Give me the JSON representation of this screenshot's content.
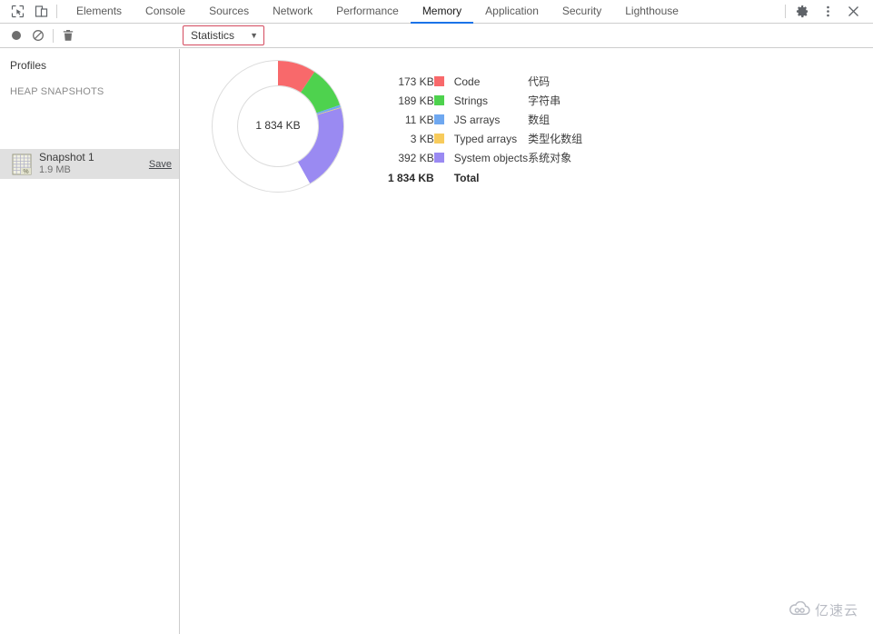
{
  "window": {
    "tabbar": {
      "left_icons": [
        {
          "name": "inspect-element-icon",
          "glyph": "inspect"
        },
        {
          "name": "device-toolbar-icon",
          "glyph": "device"
        }
      ],
      "tabs": [
        {
          "label": "Elements",
          "active": false
        },
        {
          "label": "Console",
          "active": false
        },
        {
          "label": "Sources",
          "active": false
        },
        {
          "label": "Network",
          "active": false
        },
        {
          "label": "Performance",
          "active": false
        },
        {
          "label": "Memory",
          "active": true
        },
        {
          "label": "Application",
          "active": false
        },
        {
          "label": "Security",
          "active": false
        },
        {
          "label": "Lighthouse",
          "active": false
        }
      ],
      "right_icons": [
        {
          "name": "settings-gear-icon"
        },
        {
          "name": "more-options-icon"
        },
        {
          "name": "close-icon"
        }
      ],
      "active_tab_color": "#1a73e8"
    },
    "toolbar": {
      "icons": [
        {
          "name": "record-icon"
        },
        {
          "name": "clear-icon"
        },
        {
          "name": "delete-icon"
        }
      ],
      "view_select": {
        "value": "Statistics",
        "caret": "▼",
        "highlight_color": "#d44a5e"
      }
    }
  },
  "sidebar": {
    "title": "Profiles",
    "section_label": "HEAP SNAPSHOTS",
    "snapshot": {
      "icon_name": "snapshot-file-icon",
      "name": "Snapshot 1",
      "size": "1.9 MB",
      "save_label": "Save",
      "selected": true
    }
  },
  "chart_data": {
    "type": "pie",
    "title": "",
    "center_label": "1 834 KB",
    "total": 1834,
    "unit": "KB",
    "legend_position": "right",
    "categories": [
      "Code",
      "Strings",
      "JS arrays",
      "Typed arrays",
      "System objects"
    ],
    "values": [
      173,
      189,
      11,
      3,
      392
    ],
    "value_labels": [
      "173 KB",
      "189 KB",
      "11 KB",
      "3 KB",
      "392 KB"
    ],
    "colors": [
      "#f8696b",
      "#4ed24e",
      "#6fa8f0",
      "#f7cb5c",
      "#9a8af2"
    ],
    "labels_cn": [
      "代码",
      "字符串",
      "数组",
      "类型化数组",
      "系统对象"
    ],
    "total_row": {
      "value": "1 834 KB",
      "label": "Total"
    },
    "ring_outline_color": "#d8d8d8"
  },
  "watermark": {
    "icon_name": "cloud-logo-icon",
    "text": "亿速云"
  }
}
